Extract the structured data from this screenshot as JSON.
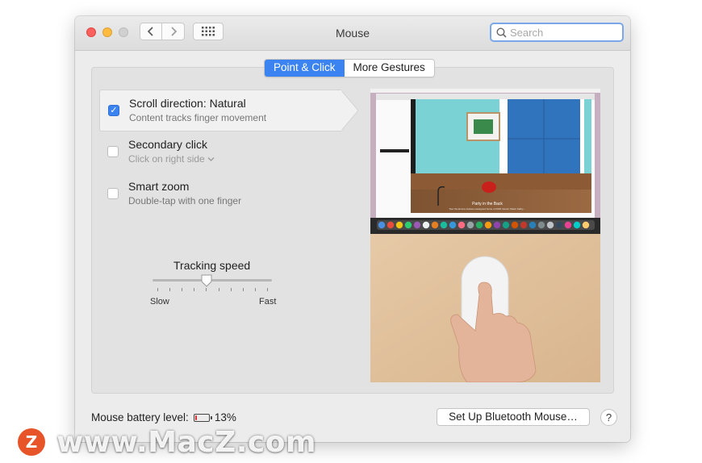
{
  "window": {
    "title": "Mouse"
  },
  "search": {
    "placeholder": "Search"
  },
  "tabs": [
    {
      "label": "Point & Click",
      "active": true
    },
    {
      "label": "More Gestures",
      "active": false
    }
  ],
  "options": [
    {
      "title": "Scroll direction: Natural",
      "subtitle": "Content tracks finger movement",
      "checked": true
    },
    {
      "title": "Secondary click",
      "subtitle": "Click on right side",
      "checked": false
    },
    {
      "title": "Smart zoom",
      "subtitle": "Double-tap with one finger",
      "checked": false
    }
  ],
  "tracking": {
    "label": "Tracking speed",
    "min_label": "Slow",
    "max_label": "Fast",
    "value_fraction": 0.45,
    "tick_count": 10
  },
  "preview": {
    "caption_title": "Party in the Back",
    "caption_sub": "Tour the Emma Jackson-designed home of 2018 Interior Talent Kathy…"
  },
  "footer": {
    "battery_label": "Mouse battery level:",
    "battery_percent": "13%",
    "battery_fraction": 0.13,
    "setup_button": "Set Up Bluetooth Mouse…",
    "help": "?"
  },
  "watermark": {
    "logo_letter": "Z",
    "text": "www.MacZ.com"
  },
  "colors": {
    "accent": "#3b83f0",
    "battery_low": "#e02b2b"
  }
}
